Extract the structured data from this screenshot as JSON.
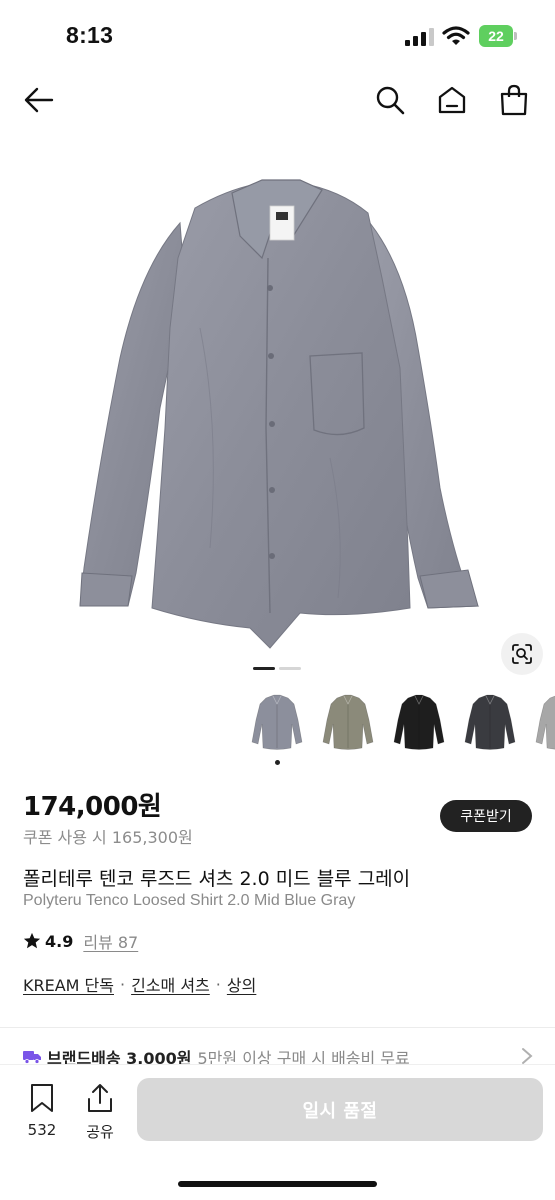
{
  "status_bar": {
    "time": "8:13",
    "battery": "22",
    "icons": [
      "signal-icon",
      "wifi-icon",
      "battery-icon"
    ]
  },
  "nav": {
    "icons": [
      "back-arrow-icon",
      "search-icon",
      "home-icon",
      "shopping-bag-icon"
    ]
  },
  "gallery": {
    "main_image_color": "#8f919c",
    "page_count": 2,
    "current_page": 1,
    "thumbnails": [
      {
        "color": "#8c8f9c"
      },
      {
        "color": "#8b8a7a"
      },
      {
        "color": "#1e1e1e"
      },
      {
        "color": "#3a3b40"
      },
      {
        "color": "#a7a7a7"
      }
    ]
  },
  "product": {
    "price": "174,000원",
    "coupon_price": "쿠폰 사용 시 165,300원",
    "coupon_button": "쿠폰받기",
    "name_ko": "폴리테루 텐코 루즈드 셔츠 2.0 미드 블루 그레이",
    "name_en": "Polyteru Tenco Loosed Shirt 2.0 Mid Blue Gray",
    "rating": "4.9",
    "review_text": "리뷰 87",
    "tags": [
      "KREAM 단독",
      "긴소매 셔츠",
      "상의"
    ],
    "tag_separator": "·"
  },
  "shipping": {
    "label": "브랜드배송 3,000원",
    "note": "5만원 이상 구매 시 배송비 무료"
  },
  "bottom_bar": {
    "bookmark_count": "532",
    "share_label": "공유",
    "buy_button": "일시 품절"
  },
  "colors": {
    "primary_dark": "#222222",
    "disabled_button": "#d8d8d8",
    "truck": "#7a55e8",
    "battery": "#5fcf5f"
  }
}
